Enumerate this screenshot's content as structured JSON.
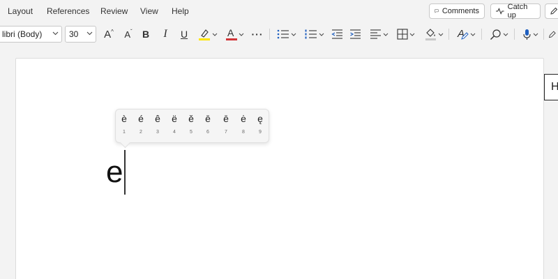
{
  "menu": {
    "items": [
      "Layout",
      "References",
      "Review",
      "View",
      "Help"
    ],
    "comments_label": "Comments",
    "catchup_label": "Catch up"
  },
  "ribbon": {
    "font_name": "libri (Body)",
    "font_size": "30",
    "icons": [
      "grow-font-icon",
      "shrink-font-icon",
      "bold-icon",
      "italic-icon",
      "underline-icon",
      "highlight-icon",
      "font-color-icon",
      "more-icon",
      "bullets-icon",
      "numbering-icon",
      "decrease-indent-icon",
      "increase-indent-icon",
      "align-icon",
      "borders-icon",
      "shading-icon",
      "styles-icon",
      "find-icon",
      "dictate-icon",
      "editor-icon"
    ],
    "bold_glyph": "B",
    "italic_glyph": "I",
    "underline_glyph": "U",
    "grow_glyph": "A",
    "shrink_glyph": "A",
    "font_color_glyph": "A",
    "styles_glyph": "A",
    "more_glyph": "···",
    "highlight_color": "#ffe600",
    "font_color": "#d13438"
  },
  "document": {
    "typed_text": "e",
    "side_label": "H"
  },
  "accent_popup": {
    "options": [
      {
        "char": "è",
        "num": "1"
      },
      {
        "char": "é",
        "num": "2"
      },
      {
        "char": "ê",
        "num": "3"
      },
      {
        "char": "ë",
        "num": "4"
      },
      {
        "char": "ě",
        "num": "5"
      },
      {
        "char": "ē",
        "num": "6"
      },
      {
        "char": "ē",
        "num": "7"
      },
      {
        "char": "ė",
        "num": "8"
      },
      {
        "char": "ę",
        "num": "9"
      }
    ]
  }
}
